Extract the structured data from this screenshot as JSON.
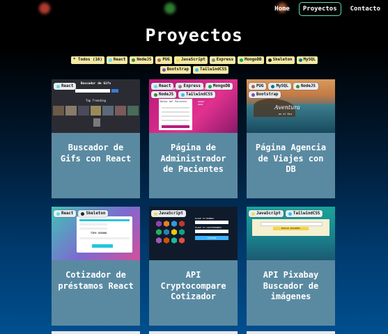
{
  "nav": {
    "items": [
      {
        "label": "Home",
        "active": false
      },
      {
        "label": "Proyectos",
        "active": true
      },
      {
        "label": "Contacto",
        "active": false
      }
    ]
  },
  "page_title": "Proyectos",
  "filters": [
    {
      "label": "* Todos (16)",
      "color": "#f4e9a3"
    },
    {
      "label": "React",
      "color": "#61dafb"
    },
    {
      "label": "NodeJS",
      "color": "#3c873a"
    },
    {
      "label": "PUG",
      "color": "#a86454"
    },
    {
      "label": "JavaScript",
      "color": "#f0db4f"
    },
    {
      "label": "Express",
      "color": "#888888"
    },
    {
      "label": "MongoDB",
      "color": "#13aa52"
    },
    {
      "label": "Skeleton",
      "color": "#222222"
    },
    {
      "label": "MySQL",
      "color": "#00758f"
    },
    {
      "label": "Bootstrap",
      "color": "#7952b3"
    },
    {
      "label": "TailwindCSS",
      "color": "#38bdf8"
    }
  ],
  "projects": [
    {
      "title": "Buscador de Gifs con React",
      "tags": [
        {
          "label": "React",
          "color": "#61dafb"
        }
      ],
      "thumb_text": [
        "Buscador de Gifs",
        "Top Trending"
      ]
    },
    {
      "title": "Página de Administrador de Pacientes",
      "tags": [
        {
          "label": "React",
          "color": "#61dafb"
        },
        {
          "label": "Express",
          "color": "#888888"
        },
        {
          "label": "MongoDB",
          "color": "#13aa52"
        },
        {
          "label": "NodeJS",
          "color": "#3c873a"
        },
        {
          "label": "TailwindCSS",
          "color": "#38bdf8"
        }
      ],
      "thumb_text": [
        "ADMINISTRADOR DE PACIENTES",
        "Datos del Paciente"
      ]
    },
    {
      "title": "Página Agencia de Viajes con DB",
      "tags": [
        {
          "label": "PUG",
          "color": "#a86454"
        },
        {
          "label": "MySQL",
          "color": "#00758f"
        },
        {
          "label": "NodeJS",
          "color": "#3c873a"
        },
        {
          "label": "Bootstrap",
          "color": "#7952b3"
        }
      ],
      "thumb_text": [
        "Aventura",
        "en el Río"
      ]
    },
    {
      "title": "Cotizador de préstamos React",
      "tags": [
        {
          "label": "React",
          "color": "#61dafb"
        },
        {
          "label": "Skeleton",
          "color": "#222222"
        }
      ],
      "thumb_text": [
        "TIPO SEGURO"
      ]
    },
    {
      "title": "API Cryptocompare Cotizador",
      "tags": [
        {
          "label": "JavaScript",
          "color": "#f0db4f"
        }
      ],
      "thumb_text": [
        "ELIGE TU MONEDA",
        "ELIGE TU CRIPTOMONEDA",
        "COTIZAR"
      ]
    },
    {
      "title": "API Pixabay Buscador de imágenes",
      "tags": [
        {
          "label": "JavaScript",
          "color": "#f0db4f"
        },
        {
          "label": "TailwindCSS",
          "color": "#38bdf8"
        }
      ],
      "thumb_text": [
        "BUSCAR IMAGENES"
      ]
    }
  ]
}
